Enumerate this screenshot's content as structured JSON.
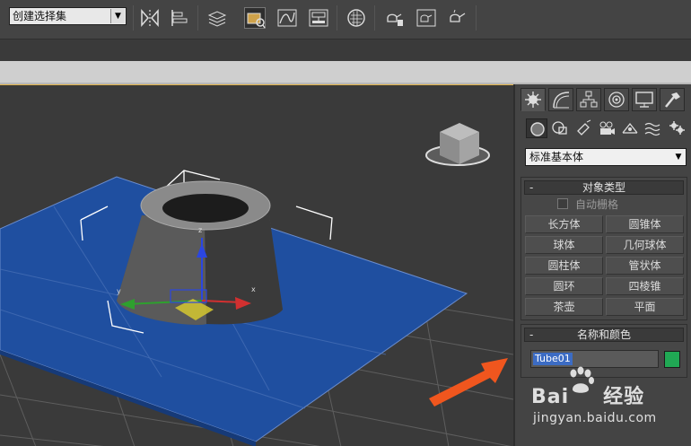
{
  "toolbar": {
    "selection_set_label": "创建选择集",
    "tools": [
      "mirror-icon",
      "align-icon",
      "layer-manager-icon",
      "scene-explorer-icon",
      "curve-editor-icon",
      "schematic-view-icon",
      "material-editor-icon",
      "render-setup-icon",
      "rendered-frame-icon",
      "render-icon"
    ]
  },
  "command_panel": {
    "tabs": [
      "create-tab",
      "modify-tab",
      "hierarchy-tab",
      "motion-tab",
      "display-tab",
      "utilities-tab"
    ],
    "sub_tabs": [
      "geometry",
      "shapes",
      "lights",
      "cameras",
      "helpers",
      "space-warps",
      "systems"
    ],
    "category": "标准基本体",
    "object_type": {
      "title": "对象类型",
      "autogrid_label": "自动栅格",
      "buttons": [
        [
          "长方体",
          "圆锥体"
        ],
        [
          "球体",
          "几何球体"
        ],
        [
          "圆柱体",
          "管状体"
        ],
        [
          "圆环",
          "四棱锥"
        ],
        [
          "茶壶",
          "平面"
        ]
      ]
    },
    "name_color": {
      "title": "名称和颜色",
      "name_value": "Tube01",
      "color": "#20a854"
    }
  },
  "viewport": {
    "object_color": "#4a4a4a",
    "plane_color": "#1f4fa0",
    "annotation_arrow_color": "#f0561e"
  },
  "watermark": {
    "brand_a": "Bai",
    "brand_b": "经验",
    "url": "jingyan.baidu.com"
  }
}
